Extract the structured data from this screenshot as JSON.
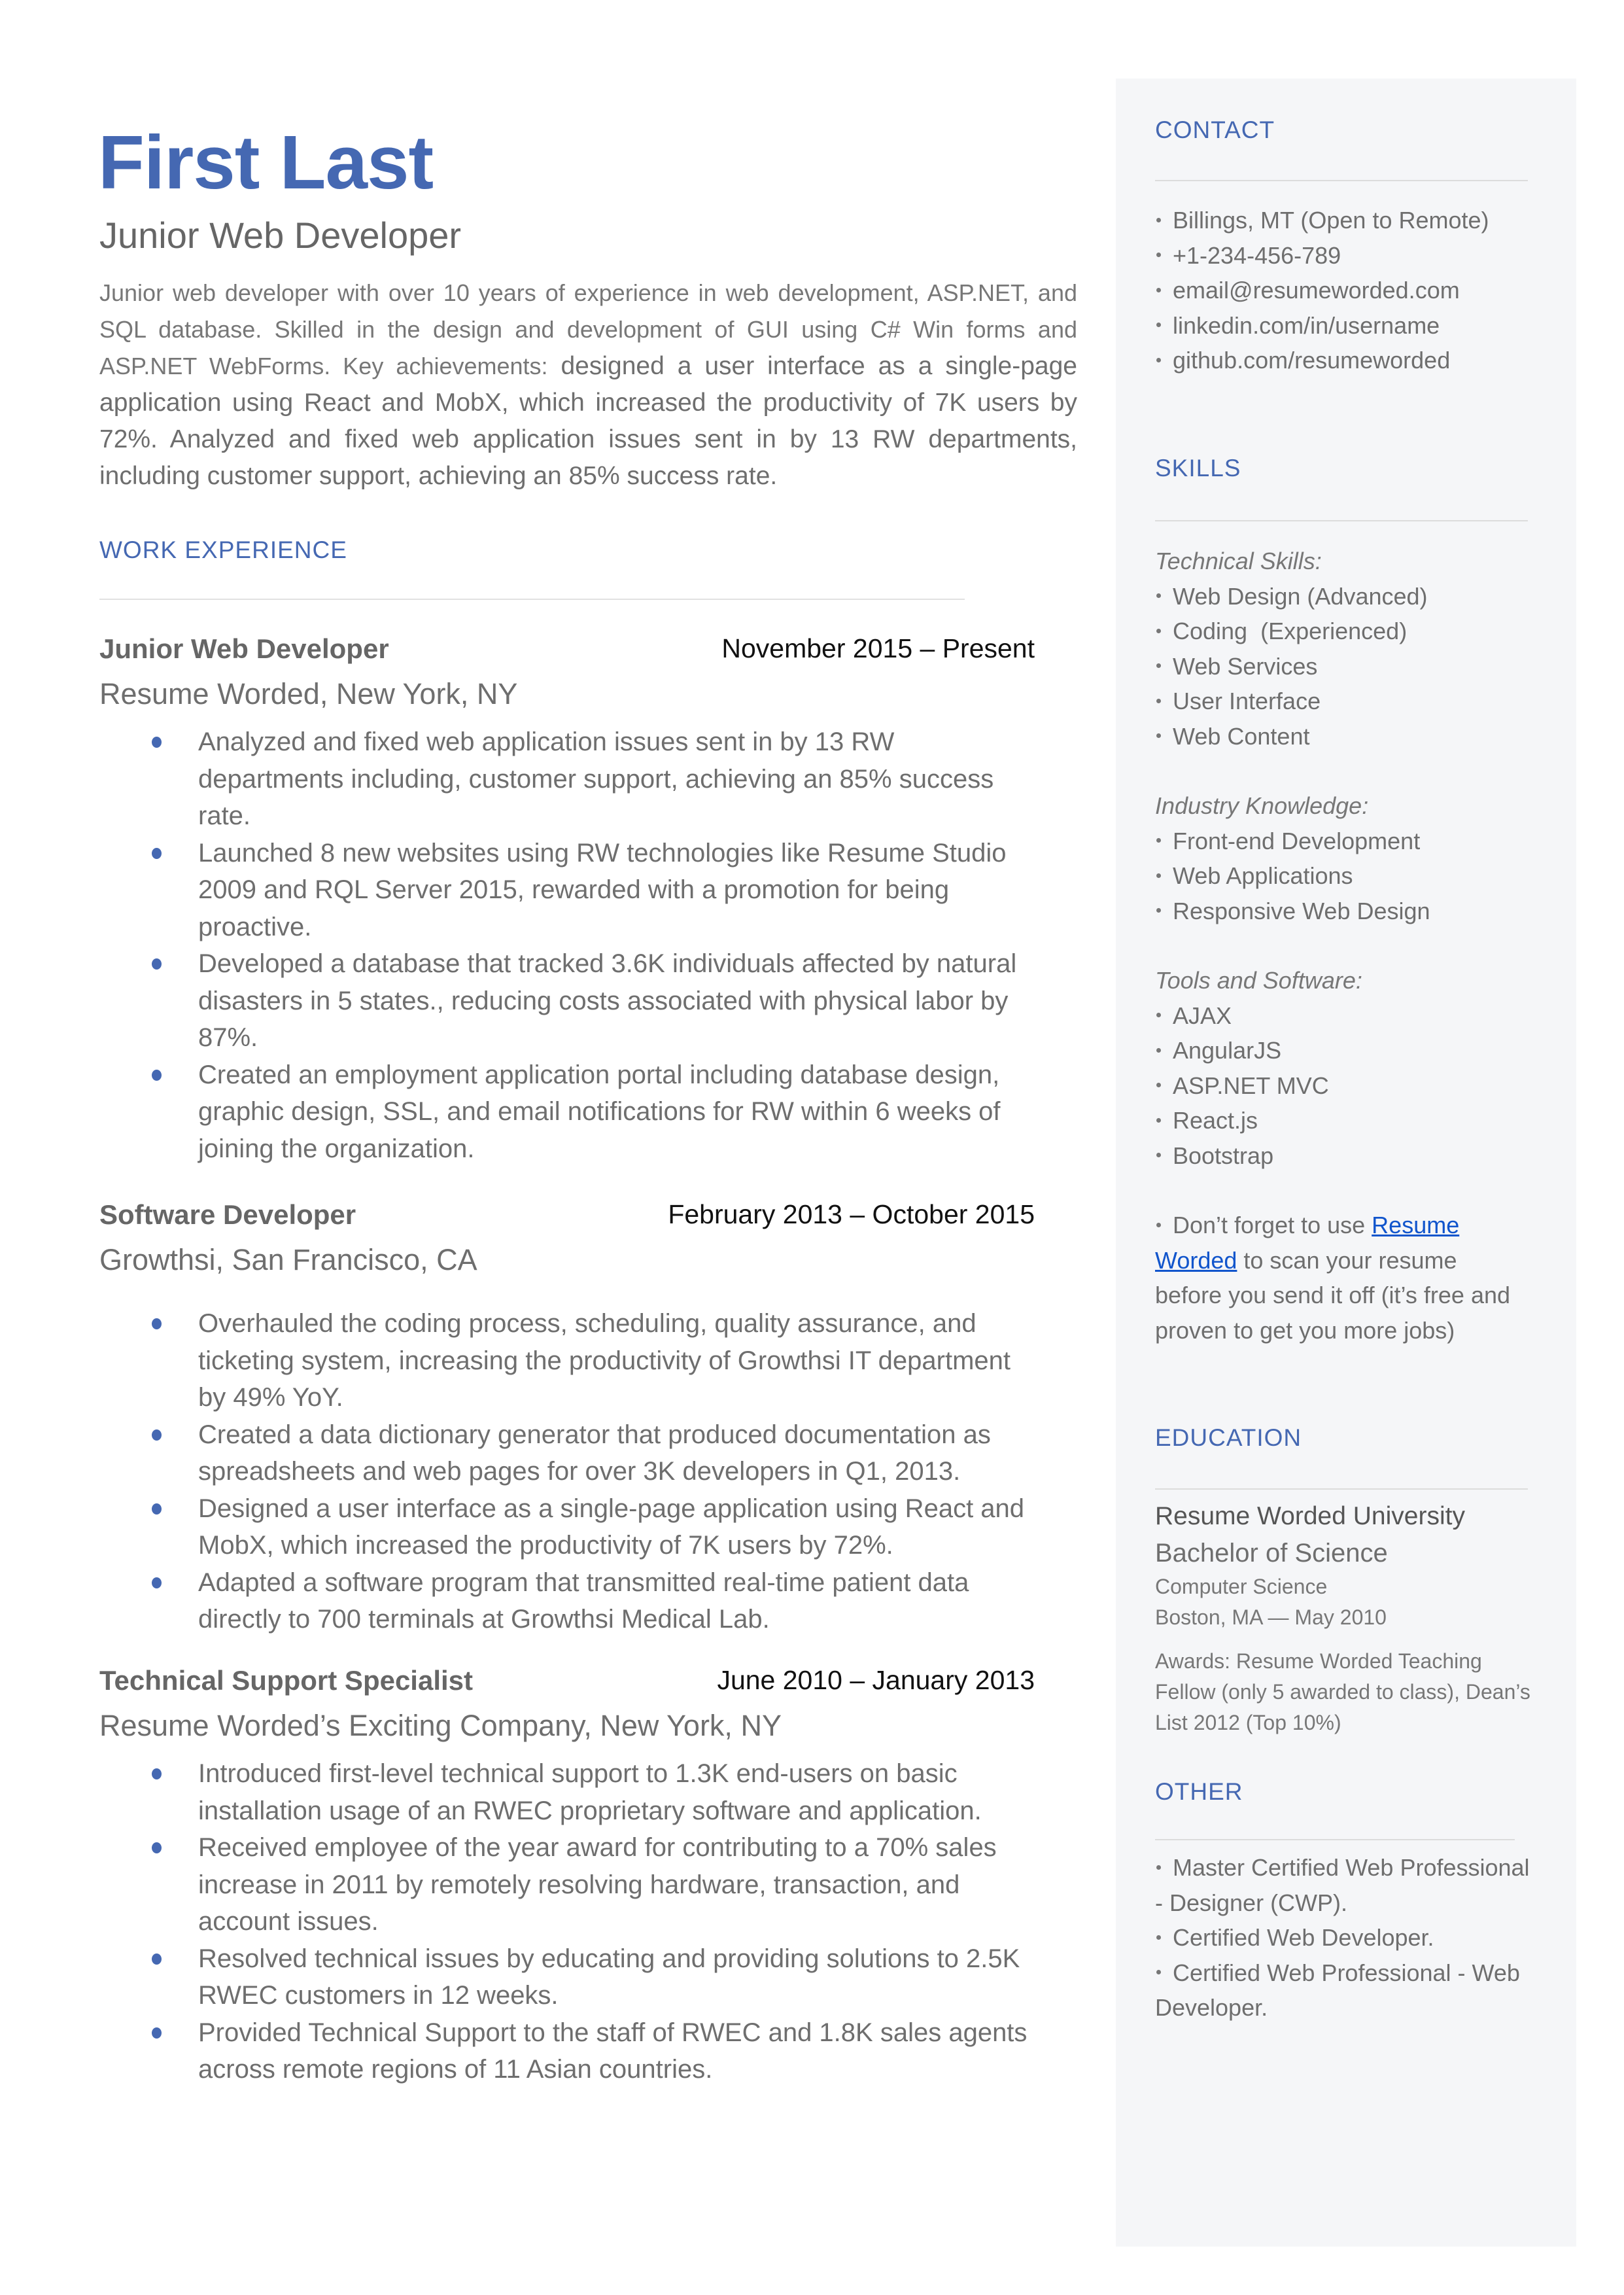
{
  "header": {
    "name": "First Last",
    "title": "Junior Web Developer",
    "summary_small": "Junior web developer with over 10 years of experience in web development, ASP.NET, and SQL database. Skilled in the design and development of GUI using C# Win forms and ASP.NET WebForms. Key achievements:",
    "summary_rest": " designed a user interface as a single-page application using React and MobX, which increased the productivity of 7K users by 72%. Analyzed and fixed web application issues sent in by 13 RW departments, including customer support, achieving an 85% success rate."
  },
  "work_experience": {
    "heading": "WORK EXPERIENCE",
    "jobs": [
      {
        "title": "Junior Web Developer",
        "dates": "November 2015 – Present",
        "company": "Resume Worded, New York, NY",
        "bullets": [
          "Analyzed and fixed web application issues sent in by 13 RW departments including, customer support, achieving an 85% success rate.",
          "Launched 8 new websites using RW technologies like Resume Studio 2009 and RQL Server 2015, rewarded with a promotion for being proactive.",
          "Developed a database that tracked 3.6K individuals affected by natural disasters in 5 states., reducing costs associated with physical labor by 87%.",
          "Created an employment application portal including database design, graphic design, SSL, and email notifications for RW within 6 weeks of joining the organization."
        ]
      },
      {
        "title": "Software Developer",
        "dates": "February 2013 – October 2015",
        "company": "Growthsi, San Francisco, CA",
        "bullets": [
          "Overhauled the coding process, scheduling, quality assurance, and ticketing system, increasing the productivity of Growthsi IT department by 49% YoY.",
          "Created a data dictionary generator that produced documentation as spreadsheets and web pages for over 3K developers in Q1, 2013.",
          "Designed a user interface as a single-page application using React and MobX, which increased the productivity of 7K users by 72%.",
          "Adapted a software program that transmitted real-time patient data directly to 700 terminals at Growthsi Medical Lab."
        ]
      },
      {
        "title": "Technical Support Specialist",
        "dates": "June 2010 – January 2013",
        "company": "Resume Worded’s Exciting Company, New York, NY",
        "bullets": [
          "Introduced first-level technical support to 1.3K end-users on basic installation usage of an RWEC proprietary software and application.",
          "Received employee of the year award for contributing to a 70% sales increase in 2011 by remotely resolving hardware, transaction, and account issues.",
          "Resolved technical issues by educating and providing solutions to 2.5K RWEC customers in 12 weeks.",
          "Provided Technical Support to the staff of RWEC and 1.8K sales agents across remote regions of 11 Asian countries."
        ]
      }
    ]
  },
  "sidebar": {
    "contact": {
      "heading": "CONTACT",
      "items": [
        "Billings, MT (Open to Remote)",
        "+1-234-456-789",
        "email@resumeworded.com",
        "linkedin.com/in/username",
        "github.com/resumeworded"
      ]
    },
    "skills": {
      "heading": "SKILLS",
      "groups": [
        {
          "label": "Technical Skills:",
          "items": [
            "Web Design (Advanced)",
            "Coding  (Experienced)",
            "Web Services",
            "User Interface",
            "Web Content"
          ]
        },
        {
          "label": "Industry Knowledge:",
          "items": [
            "Front-end Development",
            "Web Applications",
            "Responsive Web Design"
          ]
        },
        {
          "label": "Tools and Software:",
          "items": [
            "AJAX",
            "AngularJS",
            "ASP.NET MVC",
            "React.js",
            "Bootstrap"
          ]
        }
      ],
      "tip_prefix": "Don’t forget to use ",
      "tip_link": "Resume Worded",
      "tip_suffix": " to scan your resume before you send it off (it’s free and proven to get you more jobs)"
    },
    "education": {
      "heading": "EDUCATION",
      "school": "Resume Worded University",
      "degree": "Bachelor of Science",
      "field": "Computer Science",
      "location_date": "Boston, MA — May 2010",
      "awards": "Awards: Resume Worded Teaching Fellow (only 5 awarded to class), Dean’s List 2012 (Top 10%)"
    },
    "other": {
      "heading": "OTHER",
      "items": [
        "Master Certified Web Professional - Designer (CWP).",
        "Certified Web Developer.",
        "Certified Web Professional - Web Developer."
      ]
    }
  },
  "colors": {
    "accent": "#4568b2",
    "sidebar_bg": "#f5f6f8",
    "body_text": "#6e6e6e",
    "link": "#1155cc"
  }
}
